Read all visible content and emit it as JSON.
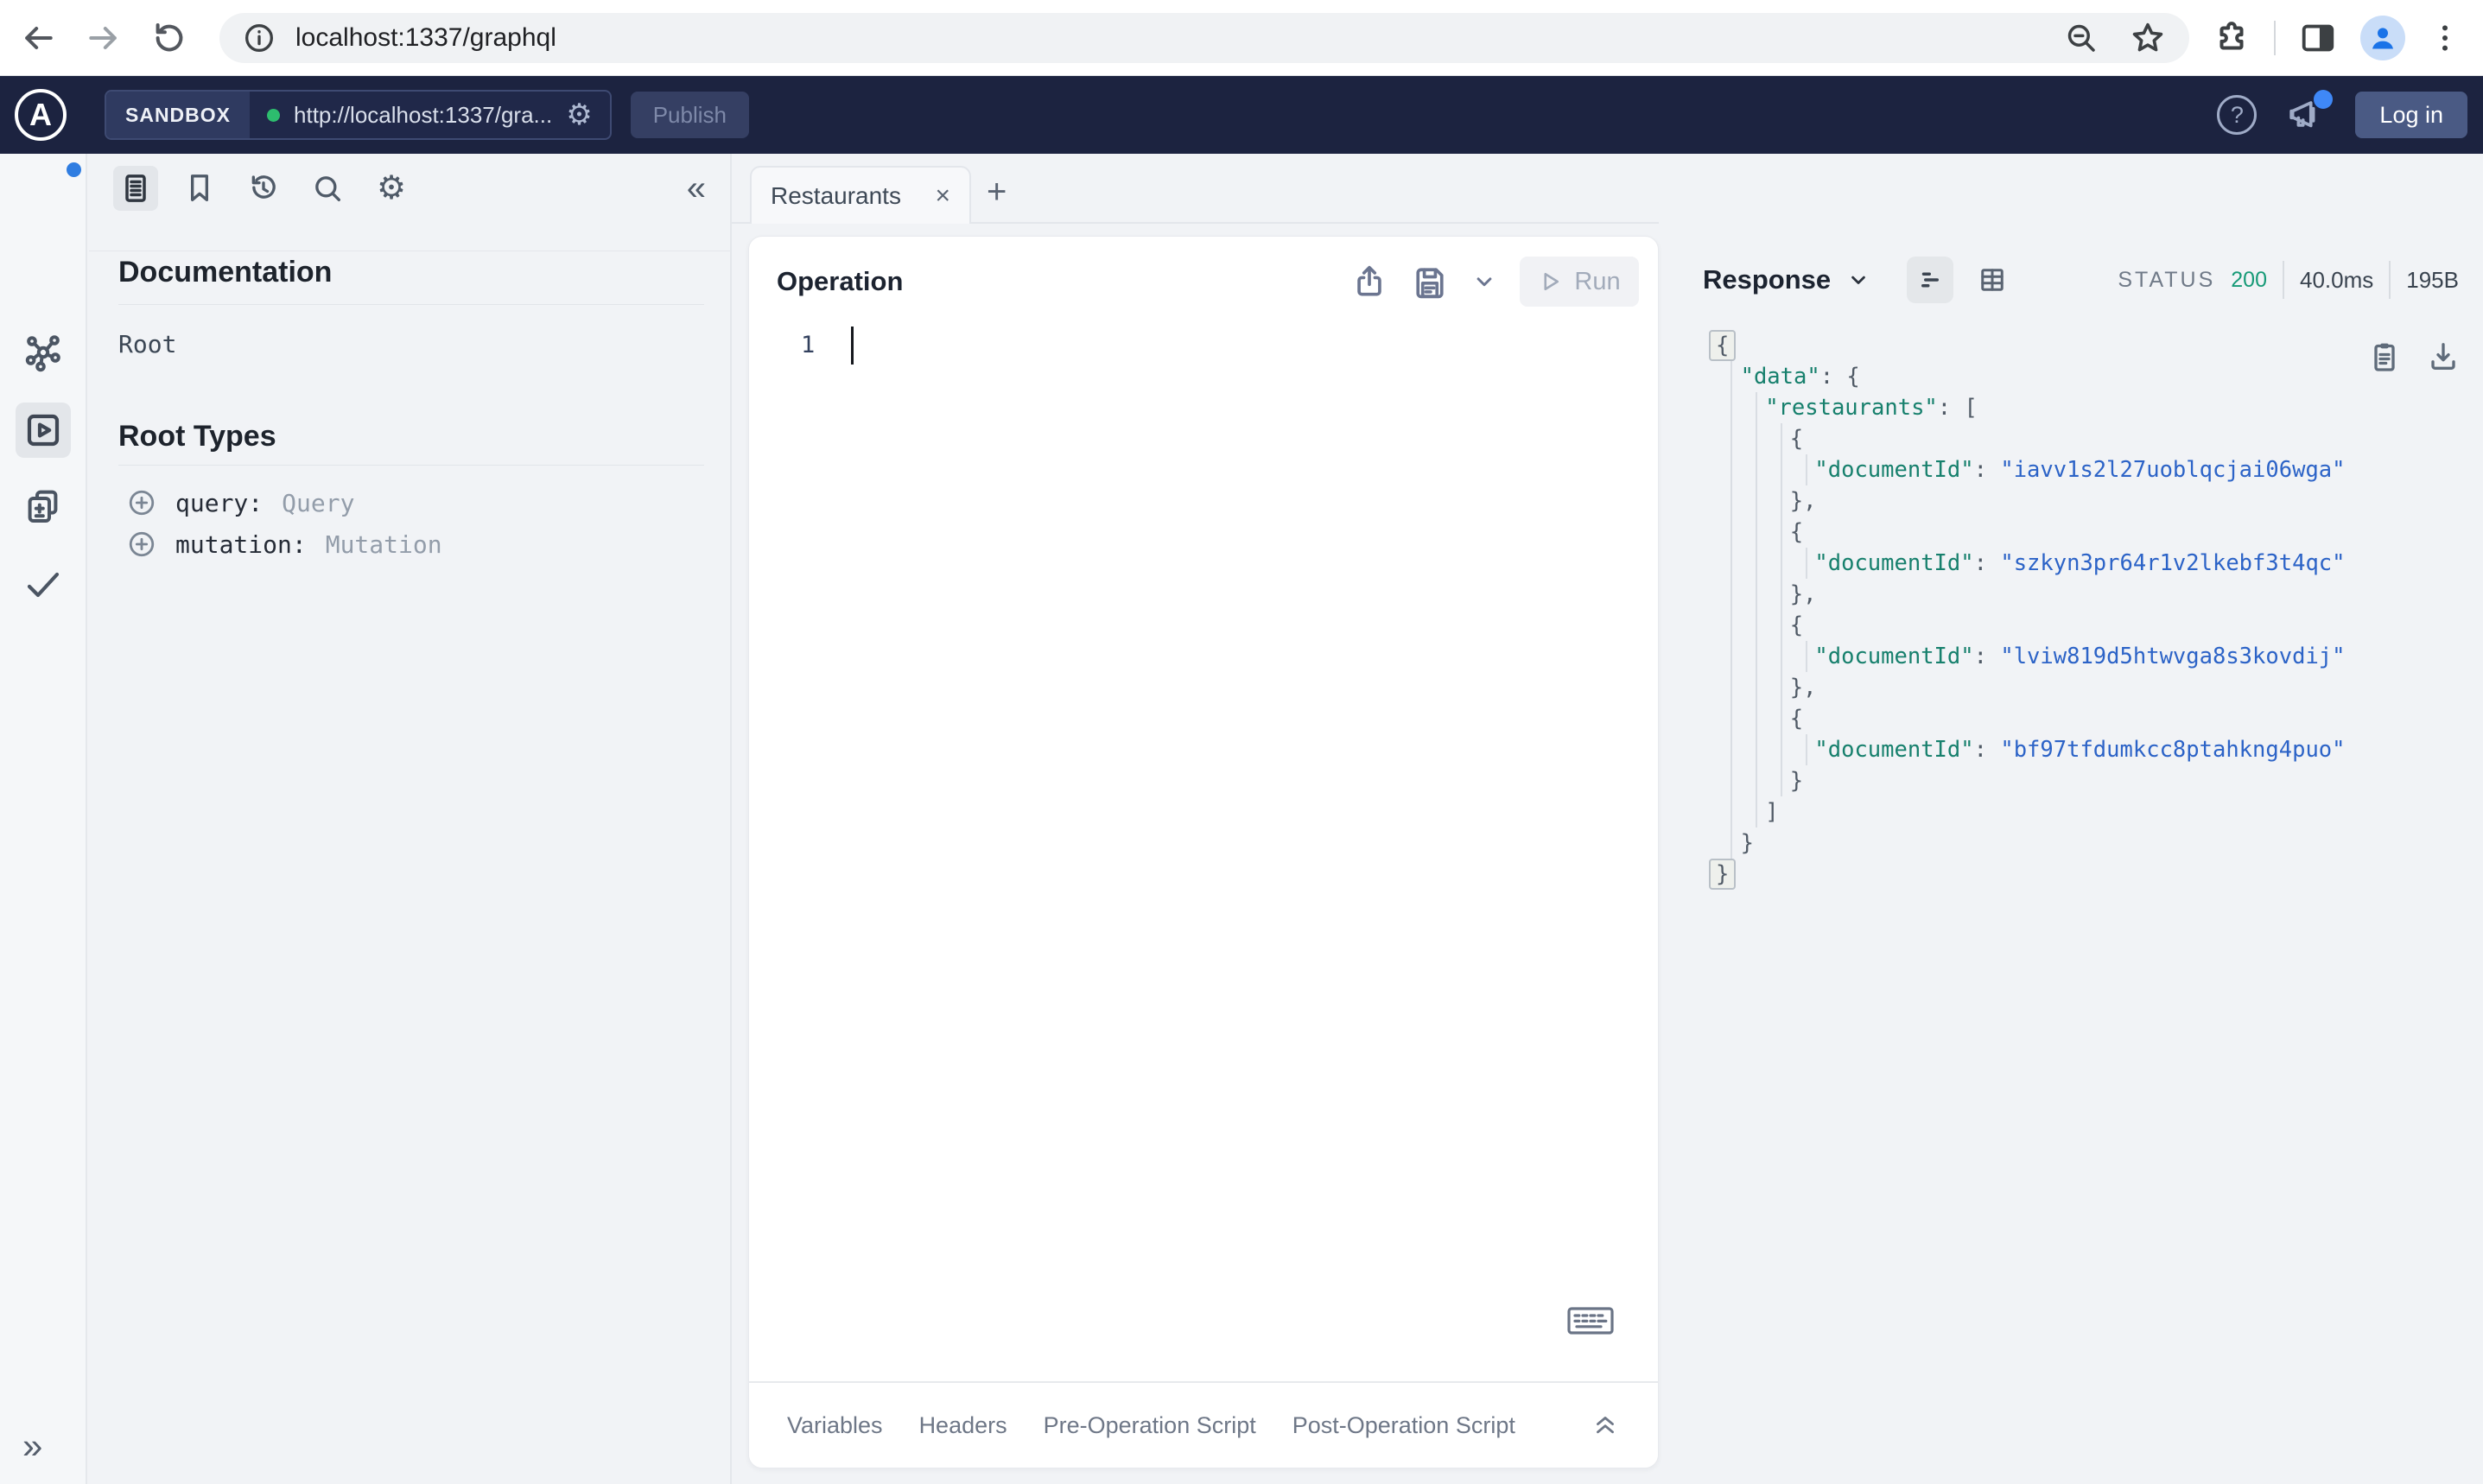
{
  "browser": {
    "url": "localhost:1337/graphql"
  },
  "apollo_header": {
    "badge": "SANDBOX",
    "endpoint": "http://localhost:1337/gra...",
    "publish": "Publish",
    "login": "Log in"
  },
  "icons": {
    "logo_letter": "A",
    "help": "?",
    "gear": "⚙",
    "collapse_left": "«",
    "expand_right": "»",
    "close_tab": "×",
    "new_tab": "+"
  },
  "docs": {
    "title": "Documentation",
    "root_item": "Root",
    "root_types_title": "Root Types",
    "root_types": [
      {
        "field": "query:",
        "type": "Query"
      },
      {
        "field": "mutation:",
        "type": "Mutation"
      }
    ]
  },
  "tabs": {
    "active": "Restaurants"
  },
  "operation": {
    "title": "Operation",
    "run": "Run",
    "line_number": "1"
  },
  "editor_tabs": [
    "Variables",
    "Headers",
    "Pre-Operation Script",
    "Post-Operation Script"
  ],
  "response": {
    "title": "Response",
    "status_label": "STATUS",
    "status_code": "200",
    "time": "40.0ms",
    "size": "195B",
    "lines": [
      {
        "indent": 0,
        "fold": true,
        "tokens": [
          [
            "p",
            "{"
          ]
        ]
      },
      {
        "indent": 1,
        "tokens": [
          [
            "k",
            "\"data\""
          ],
          [
            "p",
            ": {"
          ]
        ]
      },
      {
        "indent": 2,
        "tokens": [
          [
            "k",
            "\"restaurants\""
          ],
          [
            "p",
            ": ["
          ]
        ]
      },
      {
        "indent": 3,
        "tokens": [
          [
            "p",
            "{"
          ]
        ]
      },
      {
        "indent": 4,
        "tokens": [
          [
            "k",
            "\"documentId\""
          ],
          [
            "p",
            ": "
          ],
          [
            "s",
            "\"iavv1s2l27uoblqcjai06wga\""
          ]
        ]
      },
      {
        "indent": 3,
        "tokens": [
          [
            "p",
            "},"
          ]
        ]
      },
      {
        "indent": 3,
        "tokens": [
          [
            "p",
            "{"
          ]
        ]
      },
      {
        "indent": 4,
        "tokens": [
          [
            "k",
            "\"documentId\""
          ],
          [
            "p",
            ": "
          ],
          [
            "s",
            "\"szkyn3pr64r1v2lkebf3t4qc\""
          ]
        ]
      },
      {
        "indent": 3,
        "tokens": [
          [
            "p",
            "},"
          ]
        ]
      },
      {
        "indent": 3,
        "tokens": [
          [
            "p",
            "{"
          ]
        ]
      },
      {
        "indent": 4,
        "tokens": [
          [
            "k",
            "\"documentId\""
          ],
          [
            "p",
            ": "
          ],
          [
            "s",
            "\"lviw819d5htwvga8s3kovdij\""
          ]
        ]
      },
      {
        "indent": 3,
        "tokens": [
          [
            "p",
            "},"
          ]
        ]
      },
      {
        "indent": 3,
        "tokens": [
          [
            "p",
            "{"
          ]
        ]
      },
      {
        "indent": 4,
        "tokens": [
          [
            "k",
            "\"documentId\""
          ],
          [
            "p",
            ": "
          ],
          [
            "s",
            "\"bf97tfdumkcc8ptahkng4puo\""
          ]
        ]
      },
      {
        "indent": 3,
        "tokens": [
          [
            "p",
            "}"
          ]
        ]
      },
      {
        "indent": 2,
        "tokens": [
          [
            "p",
            "]"
          ]
        ]
      },
      {
        "indent": 1,
        "tokens": [
          [
            "p",
            "}"
          ]
        ]
      },
      {
        "indent": 0,
        "fold": true,
        "tokens": [
          [
            "p",
            "}"
          ]
        ]
      }
    ]
  },
  "colors": {
    "header_bg": "#1c2340",
    "accent_blue": "#3f88f7",
    "status_green": "#169a77",
    "json_key": "#17806d",
    "json_string": "#2c63c7"
  }
}
